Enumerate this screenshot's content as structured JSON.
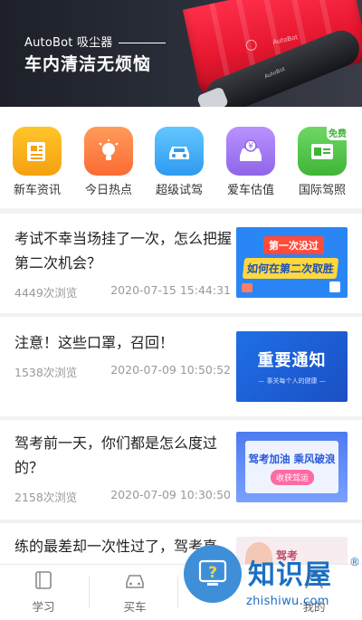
{
  "banner": {
    "brand": "AutoBot 吸尘器",
    "slogan": "车内清洁无烦恼",
    "product_mark": "AutoBot"
  },
  "shortcuts": [
    {
      "label": "新车资讯",
      "icon": "newspaper-icon",
      "color": "#f8b21b"
    },
    {
      "label": "今日热点",
      "icon": "lightbulb-icon",
      "color": "#ff8a45"
    },
    {
      "label": "超级试驾",
      "icon": "car-icon",
      "color": "#47b3f5"
    },
    {
      "label": "爱车估值",
      "icon": "car-yen-icon",
      "color": "#a97ef0"
    },
    {
      "label": "国际驾照",
      "icon": "license-icon",
      "color": "#53c84a",
      "badge": "免费"
    }
  ],
  "news": [
    {
      "title": "考试不幸当场挂了一次，怎么把握第二次机会？",
      "views": "4449次浏览",
      "date": "2020-07-15 15:44:31",
      "thumb": {
        "line1": "第一次没过",
        "line2": "如何在第二次取胜"
      }
    },
    {
      "title": "注意！这些口罩，召回！",
      "views": "1538次浏览",
      "date": "2020-07-09 10:50:52",
      "thumb": {
        "line1": "重要通知",
        "line2": "— 事关每个人的健康 —"
      }
    },
    {
      "title": "驾考前一天，你们都是怎么度过的？",
      "views": "2158次浏览",
      "date": "2020-07-09 10:30:50",
      "thumb": {
        "line1": "驾考加油 乘风破浪",
        "line2": "收获驾运"
      }
    },
    {
      "title": "练的最差却一次性过了，驾考真",
      "thumb": {
        "line1": "驾考"
      }
    }
  ],
  "tabbar": [
    {
      "label": "学习",
      "icon": "book-icon"
    },
    {
      "label": "买车",
      "icon": "car-outline-icon"
    },
    {
      "label": "",
      "icon": "help-icon"
    },
    {
      "label": "我的",
      "icon": "user-icon"
    }
  ],
  "watermark": {
    "text": "知识屋",
    "sub": "zhishiwu.com",
    "reg": "®"
  }
}
